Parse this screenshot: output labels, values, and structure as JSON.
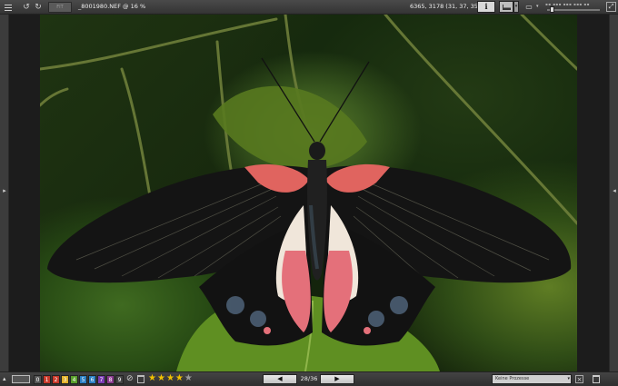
{
  "toolbar": {
    "fit_label": "FIT",
    "filename": "_8001980.NEF @ 16 %",
    "coords": "6365, 3178 (31, 37, 35)",
    "info_label": "i",
    "zoom": {
      "level_fraction": 0.05
    }
  },
  "bottom": {
    "labels": [
      {
        "text": "0",
        "color": "#555555"
      },
      {
        "text": "1",
        "color": "#c8392b"
      },
      {
        "text": "2",
        "color": "#c8392b"
      },
      {
        "text": "3",
        "color": "#e3b22a"
      },
      {
        "text": "4",
        "color": "#5aa02c"
      },
      {
        "text": "5",
        "color": "#2a7fc4"
      },
      {
        "text": "6",
        "color": "#2a7fc4"
      },
      {
        "text": "7",
        "color": "#7a3bb3"
      },
      {
        "text": "8",
        "color": "#8a3b8e"
      },
      {
        "text": "9",
        "color": "#444444"
      }
    ],
    "rating": 4,
    "rating_max": 5,
    "prev_label": "◀",
    "next_label": "▶",
    "page": "28/36",
    "process_value": "Keine Prozesse"
  },
  "icons": {
    "menu": "hamburger-icon",
    "rotate_left": "rotate-left-icon",
    "rotate_right": "rotate-right-icon",
    "collapse_left": "chevron-left-icon",
    "collapse_right": "chevron-right-icon"
  }
}
